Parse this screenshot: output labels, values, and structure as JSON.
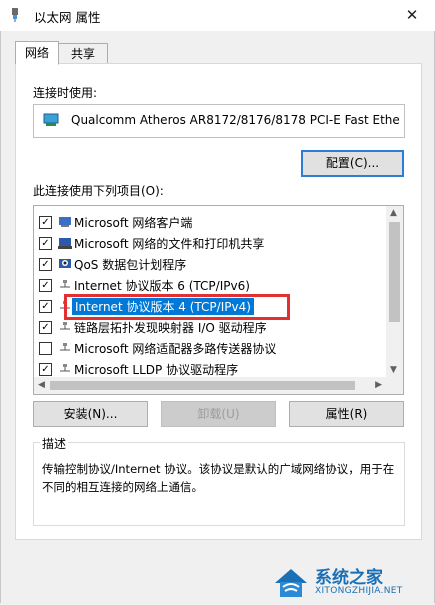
{
  "window": {
    "title": "以太网 属性"
  },
  "tabs": [
    {
      "label": "网络",
      "active": true
    },
    {
      "label": "共享",
      "active": false
    }
  ],
  "connect_using": {
    "label": "连接时使用:",
    "adapter": "Qualcomm Atheros AR8172/8176/8178 PCI-E Fast Ethe",
    "configure_button": "配置(C)..."
  },
  "items_section": {
    "label": "此连接使用下列项目(O):",
    "items": [
      {
        "label": "Microsoft 网络客户端",
        "checked": true,
        "icon": "network-client-icon"
      },
      {
        "label": "Microsoft 网络的文件和打印机共享",
        "checked": true,
        "icon": "printer-share-icon"
      },
      {
        "label": "QoS 数据包计划程序",
        "checked": true,
        "icon": "qos-icon"
      },
      {
        "label": "Internet 协议版本 6 (TCP/IPv6)",
        "checked": true,
        "icon": "protocol-icon"
      },
      {
        "label": "Internet 协议版本 4 (TCP/IPv4)",
        "checked": true,
        "icon": "protocol-icon",
        "selected": true
      },
      {
        "label": "链路层拓扑发现映射器 I/O 驱动程序",
        "checked": true,
        "icon": "protocol-icon"
      },
      {
        "label": "Microsoft 网络适配器多路传送器协议",
        "checked": false,
        "icon": "protocol-icon"
      },
      {
        "label": "Microsoft LLDP 协议驱动程序",
        "checked": true,
        "icon": "protocol-icon"
      }
    ]
  },
  "buttons": {
    "install": "安装(N)...",
    "uninstall": "卸载(U)",
    "properties": "属性(R)"
  },
  "description": {
    "title": "描述",
    "text": "传输控制协议/Internet 协议。该协议是默认的广域网络协议，用于在不同的相互连接的网络上通信。"
  },
  "watermark": {
    "brand": "系统之家",
    "url": "XITONGZHIJIA.NET"
  },
  "colors": {
    "selection": "#0078d7",
    "highlight_box": "#e03030",
    "default_button_border": "#2f7bd8"
  }
}
